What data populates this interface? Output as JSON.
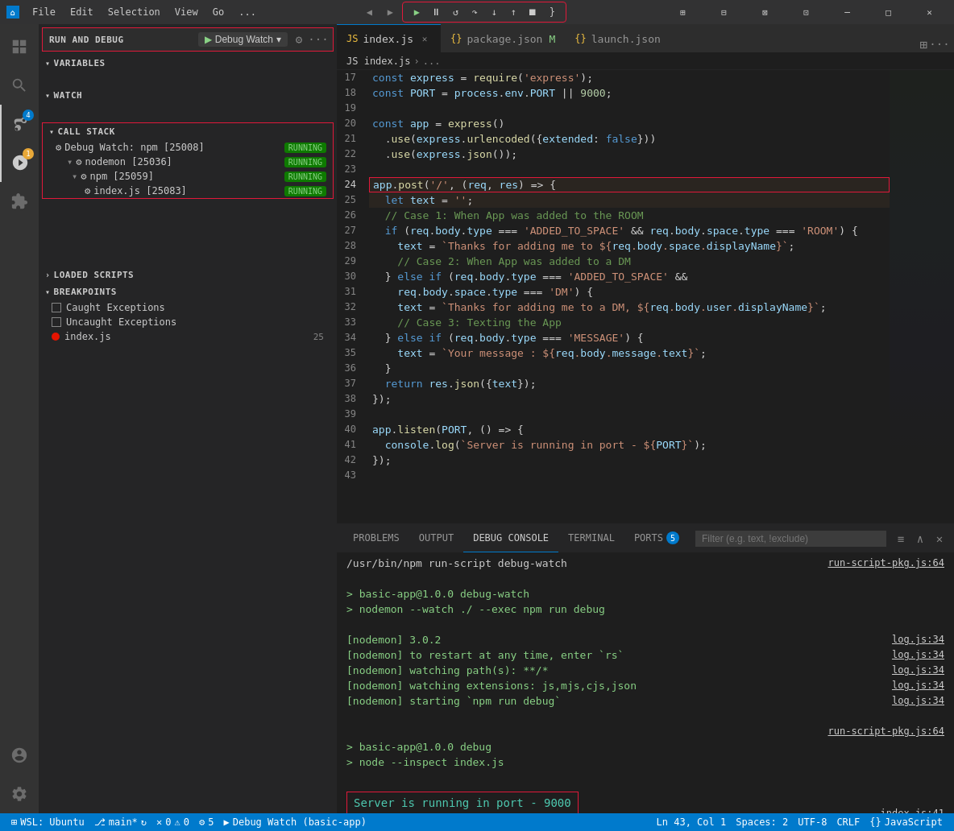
{
  "titleBar": {
    "appName": "Visual Studio Code",
    "menu": [
      "File",
      "Edit",
      "Selection",
      "View",
      "Go",
      "..."
    ],
    "windowControls": [
      "─",
      "□",
      "✕"
    ]
  },
  "debugToolbar": {
    "buttons": [
      "▶",
      "⏸",
      "↺",
      "↓",
      "↑",
      "⟳",
      "□",
      "}"
    ]
  },
  "sidebar": {
    "runAndDebugLabel": "RUN AND DEBUG",
    "debugWatchLabel": "Debug Watch",
    "variablesLabel": "VARIABLES",
    "watchLabel": "WATCH",
    "callStackLabel": "CALL STACK",
    "callStackItems": [
      {
        "name": "Debug Watch: npm [25008]",
        "status": "RUNNING",
        "level": 0
      },
      {
        "name": "nodemon [25036]",
        "status": "RUNNING",
        "level": 1
      },
      {
        "name": "npm [25059]",
        "status": "RUNNING",
        "level": 2
      },
      {
        "name": "index.js [25083]",
        "status": "RUNNING",
        "level": 3
      }
    ],
    "loadedScriptsLabel": "LOADED SCRIPTS",
    "breakpointsLabel": "BREAKPOINTS",
    "breakpoints": [
      {
        "type": "checkbox",
        "label": "Caught Exceptions",
        "checked": false
      },
      {
        "type": "checkbox",
        "label": "Uncaught Exceptions",
        "checked": false
      },
      {
        "type": "dot",
        "label": "index.js",
        "line": "25"
      }
    ]
  },
  "tabs": [
    {
      "label": "index.js",
      "icon": "JS",
      "active": true,
      "modified": false,
      "closeable": true
    },
    {
      "label": "package.json M",
      "icon": "{}",
      "active": false,
      "modified": true,
      "closeable": false
    },
    {
      "label": "launch.json",
      "icon": "{}",
      "active": false,
      "modified": false,
      "closeable": false
    }
  ],
  "breadcrumb": {
    "parts": [
      "index.js",
      "...",
      ""
    ]
  },
  "codeLines": [
    {
      "num": 17,
      "content": "const express = require('express');"
    },
    {
      "num": 18,
      "content": "const PORT = process.env.PORT || 9000;"
    },
    {
      "num": 19,
      "content": ""
    },
    {
      "num": 20,
      "content": "const app = express()"
    },
    {
      "num": 21,
      "content": "  .use(express.urlencoded({extended: false}))"
    },
    {
      "num": 22,
      "content": "  .use(express.json());"
    },
    {
      "num": 23,
      "content": ""
    },
    {
      "num": 24,
      "content": "app.post('/', (req, res) => {",
      "breakpointHighlight": true
    },
    {
      "num": 25,
      "content": "  let text = '';",
      "breakpoint": true
    },
    {
      "num": 26,
      "content": "  // Case 1: When App was added to the ROOM"
    },
    {
      "num": 27,
      "content": "  if (req.body.type === 'ADDED_TO_SPACE' && req.body.space.type === 'ROOM') {"
    },
    {
      "num": 28,
      "content": "    text = `Thanks for adding me to ${req.body.space.displayName}`;"
    },
    {
      "num": 29,
      "content": "    // Case 2: When App was added to a DM"
    },
    {
      "num": 30,
      "content": "  } else if (req.body.type === 'ADDED_TO_SPACE' &&"
    },
    {
      "num": 31,
      "content": "    req.body.space.type === 'DM') {"
    },
    {
      "num": 32,
      "content": "    text = `Thanks for adding me to a DM, ${req.body.user.displayName}`;"
    },
    {
      "num": 33,
      "content": "    // Case 3: Texting the App"
    },
    {
      "num": 34,
      "content": "  } else if (req.body.type === 'MESSAGE') {"
    },
    {
      "num": 35,
      "content": "    text = `Your message : ${req.body.message.text}`;"
    },
    {
      "num": 36,
      "content": "  }"
    },
    {
      "num": 37,
      "content": "  return res.json({text});"
    },
    {
      "num": 38,
      "content": "});"
    },
    {
      "num": 39,
      "content": ""
    },
    {
      "num": 40,
      "content": "app.listen(PORT, () => {"
    },
    {
      "num": 41,
      "content": "  console.log(`Server is running in port - ${PORT}`);"
    },
    {
      "num": 42,
      "content": "});"
    },
    {
      "num": 43,
      "content": ""
    }
  ],
  "panelTabs": [
    {
      "label": "PROBLEMS",
      "active": false
    },
    {
      "label": "OUTPUT",
      "active": false
    },
    {
      "label": "DEBUG CONSOLE",
      "active": true
    },
    {
      "label": "TERMINAL",
      "active": false
    },
    {
      "label": "PORTS",
      "active": false,
      "badge": "5"
    }
  ],
  "panelFilter": {
    "placeholder": "Filter (e.g. text, !exclude)"
  },
  "consoleOutput": [
    {
      "text": "/usr/bin/npm run-script debug-watch",
      "align": "left",
      "link": null
    },
    {
      "link": "run-script-pkg.js:64",
      "align": "right"
    },
    {
      "text": "",
      "align": "left"
    },
    {
      "text": "> basic-app@1.0.0 debug-watch",
      "color": "green"
    },
    {
      "text": "> nodemon --watch ./ --exec npm run debug",
      "color": "green"
    },
    {
      "text": "",
      "align": "left"
    },
    {
      "text": "[nodemon] 3.0.2",
      "color": "green"
    },
    {
      "link2": "log.js:34",
      "text2": "[nodemon] 3.0.2"
    },
    {
      "text": "[nodemon] to restart at any time, enter `rs`",
      "color": "green",
      "link": "log.js:34"
    },
    {
      "text": "[nodemon] watching path(s): **/*",
      "color": "green",
      "link": "log.js:34"
    },
    {
      "text": "[nodemon] watching extensions: js,mjs,cjs,json",
      "color": "green",
      "link": "log.js:34"
    },
    {
      "text": "[nodemon] starting `npm run debug`",
      "color": "green",
      "link": "log.js:34"
    },
    {
      "text": "",
      "align": "left"
    },
    {
      "link": "run-script-pkg.js:64",
      "text": ""
    },
    {
      "text": "> basic-app@1.0.0 debug",
      "color": "green"
    },
    {
      "text": "> node --inspect index.js",
      "color": "green"
    },
    {
      "text": "",
      "align": "left"
    },
    {
      "text": "Server is running in port - 9000",
      "highlight": true,
      "link": "index.js:41"
    }
  ],
  "statusBar": {
    "wsl": "WSL: Ubuntu",
    "branch": "main*",
    "sync": "",
    "errors": "0",
    "warnings": "0",
    "debugSessions": "5",
    "debugName": "Debug Watch (basic-app)",
    "position": "Ln 43, Col 1",
    "spaces": "Spaces: 2",
    "encoding": "UTF-8",
    "lineEnding": "CRLF",
    "language": "JavaScript"
  }
}
